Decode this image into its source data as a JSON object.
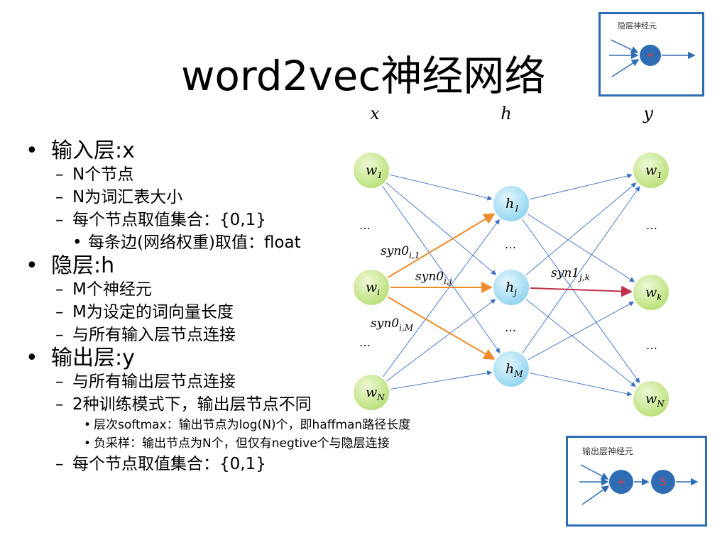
{
  "title": "word2vec神经网络",
  "bullets": [
    {
      "level": 1,
      "marker": "•",
      "text": "输入层:x"
    },
    {
      "level": 2,
      "marker": "–",
      "text": "N个节点"
    },
    {
      "level": 2,
      "marker": "–",
      "text": "N为词汇表大小"
    },
    {
      "level": 2,
      "marker": "–",
      "text": "每个节点取值集合：{0,1}"
    },
    {
      "level": "2b",
      "marker": "•",
      "text": "每条边(网络权重)取值：float"
    },
    {
      "level": 1,
      "marker": "•",
      "text": "隐层:h"
    },
    {
      "level": 2,
      "marker": "–",
      "text": "M个神经元"
    },
    {
      "level": 2,
      "marker": "–",
      "text": "M为设定的词向量长度"
    },
    {
      "level": 2,
      "marker": "–",
      "text": "与所有输入层节点连接"
    },
    {
      "level": 1,
      "marker": "•",
      "text": "输出层:y"
    },
    {
      "level": 2,
      "marker": "–",
      "text": "与所有输出层节点连接"
    },
    {
      "level": 2,
      "marker": "–",
      "text": "2种训练模式下，输出层节点不同"
    },
    {
      "level": 3,
      "marker": "•",
      "text": "层次softmax：输出节点为log(N)个，即haffman路径长度"
    },
    {
      "level": 3,
      "marker": "•",
      "text": "负采样：输出节点为N个，但仅有negtive个与隐层连接"
    },
    {
      "level": 2,
      "marker": "–",
      "text": "每个节点取值集合：{0,1}"
    }
  ],
  "network": {
    "layer_labels": {
      "input": "x",
      "hidden": "h",
      "output": "y"
    },
    "input_nodes": [
      {
        "base": "w",
        "sub": "1"
      },
      {
        "base": "w",
        "sub": "i"
      },
      {
        "base": "w",
        "sub": "N"
      }
    ],
    "hidden_nodes": [
      {
        "base": "h",
        "sub": "1"
      },
      {
        "base": "h",
        "sub": "j"
      },
      {
        "base": "h",
        "sub": "M"
      }
    ],
    "output_nodes": [
      {
        "base": "w",
        "sub": "1"
      },
      {
        "base": "w",
        "sub": "k"
      },
      {
        "base": "w",
        "sub": "N"
      }
    ],
    "ellipsis": "…",
    "edge_labels": [
      {
        "base": "syn0",
        "sub": "i,1"
      },
      {
        "base": "syn0",
        "sub": "i,j"
      },
      {
        "base": "syn0",
        "sub": "i,M"
      },
      {
        "base": "syn1",
        "sub": "j,k"
      }
    ],
    "colors": {
      "input_node": "#c9e98a",
      "hidden_node": "#a8e0f5",
      "output_node": "#c9e98a",
      "edge": "#3a6fc2",
      "highlight_in": "#f08a2a",
      "highlight_out": "#c0304a"
    }
  },
  "hidden_neuron_box": {
    "title": "隐层神经元",
    "symbol": "+"
  },
  "output_neuron_box": {
    "title": "输出层神经元",
    "symbols": [
      "+",
      "S"
    ]
  }
}
